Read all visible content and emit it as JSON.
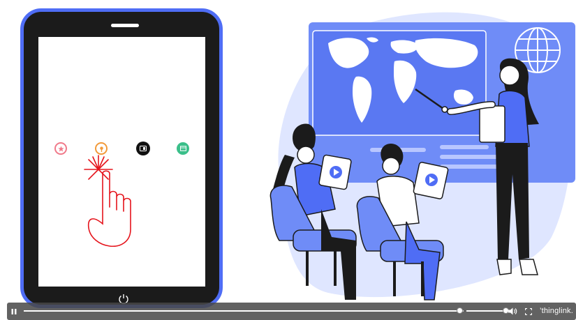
{
  "colors": {
    "accent_blue": "#4f6df5",
    "light_blue": "#dfe6ff",
    "mid_blue": "#6f8cf7",
    "dark": "#1b1b1b",
    "hotspot_pink": "#f07a8a",
    "hotspot_orange": "#f29a3a",
    "hotspot_black": "#111111",
    "hotspot_green": "#3bbf8a",
    "tap_red": "#e5141c"
  },
  "tablet": {
    "hotspots": [
      {
        "name": "hotspot-star-icon",
        "color": "#f07a8a",
        "icon": "star-icon"
      },
      {
        "name": "hotspot-pin-icon",
        "color": "#f29a3a",
        "icon": "pin-icon"
      },
      {
        "name": "hotspot-media-icon",
        "color": "#111111",
        "icon": "media-icon"
      },
      {
        "name": "hotspot-panel-icon",
        "color": "#3bbf8a",
        "icon": "panel-icon"
      }
    ]
  },
  "player": {
    "progress": 0.99,
    "volume": 1.0,
    "brand_label": "’thinglink."
  }
}
